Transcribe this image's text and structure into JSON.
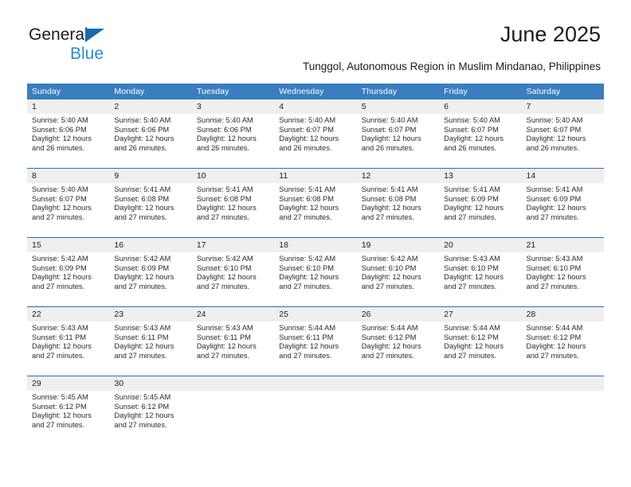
{
  "brand": {
    "line1": "General",
    "line2": "Blue",
    "triangle_icon": "triangle-icon",
    "colors": {
      "triangle": "#1769b0",
      "blue_text": "#2e8bd4",
      "dark_text": "#1c1c1c"
    }
  },
  "header": {
    "title": "June 2025",
    "subtitle": "Tunggol, Autonomous Region in Muslim Mindanao, Philippines"
  },
  "calendar": {
    "header_bg": "#3a7dc0",
    "row_separator": "#2f6eb0",
    "daynum_bg": "#efefef",
    "weekday_headers": [
      "Sunday",
      "Monday",
      "Tuesday",
      "Wednesday",
      "Thursday",
      "Friday",
      "Saturday"
    ],
    "weeks": [
      [
        {
          "day": "1",
          "sunrise": "Sunrise: 5:40 AM",
          "sunset": "Sunset: 6:06 PM",
          "daylight": "Daylight: 12 hours and 26 minutes."
        },
        {
          "day": "2",
          "sunrise": "Sunrise: 5:40 AM",
          "sunset": "Sunset: 6:06 PM",
          "daylight": "Daylight: 12 hours and 26 minutes."
        },
        {
          "day": "3",
          "sunrise": "Sunrise: 5:40 AM",
          "sunset": "Sunset: 6:06 PM",
          "daylight": "Daylight: 12 hours and 26 minutes."
        },
        {
          "day": "4",
          "sunrise": "Sunrise: 5:40 AM",
          "sunset": "Sunset: 6:07 PM",
          "daylight": "Daylight: 12 hours and 26 minutes."
        },
        {
          "day": "5",
          "sunrise": "Sunrise: 5:40 AM",
          "sunset": "Sunset: 6:07 PM",
          "daylight": "Daylight: 12 hours and 26 minutes."
        },
        {
          "day": "6",
          "sunrise": "Sunrise: 5:40 AM",
          "sunset": "Sunset: 6:07 PM",
          "daylight": "Daylight: 12 hours and 26 minutes."
        },
        {
          "day": "7",
          "sunrise": "Sunrise: 5:40 AM",
          "sunset": "Sunset: 6:07 PM",
          "daylight": "Daylight: 12 hours and 26 minutes."
        }
      ],
      [
        {
          "day": "8",
          "sunrise": "Sunrise: 5:40 AM",
          "sunset": "Sunset: 6:07 PM",
          "daylight": "Daylight: 12 hours and 27 minutes."
        },
        {
          "day": "9",
          "sunrise": "Sunrise: 5:41 AM",
          "sunset": "Sunset: 6:08 PM",
          "daylight": "Daylight: 12 hours and 27 minutes."
        },
        {
          "day": "10",
          "sunrise": "Sunrise: 5:41 AM",
          "sunset": "Sunset: 6:08 PM",
          "daylight": "Daylight: 12 hours and 27 minutes."
        },
        {
          "day": "11",
          "sunrise": "Sunrise: 5:41 AM",
          "sunset": "Sunset: 6:08 PM",
          "daylight": "Daylight: 12 hours and 27 minutes."
        },
        {
          "day": "12",
          "sunrise": "Sunrise: 5:41 AM",
          "sunset": "Sunset: 6:08 PM",
          "daylight": "Daylight: 12 hours and 27 minutes."
        },
        {
          "day": "13",
          "sunrise": "Sunrise: 5:41 AM",
          "sunset": "Sunset: 6:09 PM",
          "daylight": "Daylight: 12 hours and 27 minutes."
        },
        {
          "day": "14",
          "sunrise": "Sunrise: 5:41 AM",
          "sunset": "Sunset: 6:09 PM",
          "daylight": "Daylight: 12 hours and 27 minutes."
        }
      ],
      [
        {
          "day": "15",
          "sunrise": "Sunrise: 5:42 AM",
          "sunset": "Sunset: 6:09 PM",
          "daylight": "Daylight: 12 hours and 27 minutes."
        },
        {
          "day": "16",
          "sunrise": "Sunrise: 5:42 AM",
          "sunset": "Sunset: 6:09 PM",
          "daylight": "Daylight: 12 hours and 27 minutes."
        },
        {
          "day": "17",
          "sunrise": "Sunrise: 5:42 AM",
          "sunset": "Sunset: 6:10 PM",
          "daylight": "Daylight: 12 hours and 27 minutes."
        },
        {
          "day": "18",
          "sunrise": "Sunrise: 5:42 AM",
          "sunset": "Sunset: 6:10 PM",
          "daylight": "Daylight: 12 hours and 27 minutes."
        },
        {
          "day": "19",
          "sunrise": "Sunrise: 5:42 AM",
          "sunset": "Sunset: 6:10 PM",
          "daylight": "Daylight: 12 hours and 27 minutes."
        },
        {
          "day": "20",
          "sunrise": "Sunrise: 5:43 AM",
          "sunset": "Sunset: 6:10 PM",
          "daylight": "Daylight: 12 hours and 27 minutes."
        },
        {
          "day": "21",
          "sunrise": "Sunrise: 5:43 AM",
          "sunset": "Sunset: 6:10 PM",
          "daylight": "Daylight: 12 hours and 27 minutes."
        }
      ],
      [
        {
          "day": "22",
          "sunrise": "Sunrise: 5:43 AM",
          "sunset": "Sunset: 6:11 PM",
          "daylight": "Daylight: 12 hours and 27 minutes."
        },
        {
          "day": "23",
          "sunrise": "Sunrise: 5:43 AM",
          "sunset": "Sunset: 6:11 PM",
          "daylight": "Daylight: 12 hours and 27 minutes."
        },
        {
          "day": "24",
          "sunrise": "Sunrise: 5:43 AM",
          "sunset": "Sunset: 6:11 PM",
          "daylight": "Daylight: 12 hours and 27 minutes."
        },
        {
          "day": "25",
          "sunrise": "Sunrise: 5:44 AM",
          "sunset": "Sunset: 6:11 PM",
          "daylight": "Daylight: 12 hours and 27 minutes."
        },
        {
          "day": "26",
          "sunrise": "Sunrise: 5:44 AM",
          "sunset": "Sunset: 6:12 PM",
          "daylight": "Daylight: 12 hours and 27 minutes."
        },
        {
          "day": "27",
          "sunrise": "Sunrise: 5:44 AM",
          "sunset": "Sunset: 6:12 PM",
          "daylight": "Daylight: 12 hours and 27 minutes."
        },
        {
          "day": "28",
          "sunrise": "Sunrise: 5:44 AM",
          "sunset": "Sunset: 6:12 PM",
          "daylight": "Daylight: 12 hours and 27 minutes."
        }
      ],
      [
        {
          "day": "29",
          "sunrise": "Sunrise: 5:45 AM",
          "sunset": "Sunset: 6:12 PM",
          "daylight": "Daylight: 12 hours and 27 minutes."
        },
        {
          "day": "30",
          "sunrise": "Sunrise: 5:45 AM",
          "sunset": "Sunset: 6:12 PM",
          "daylight": "Daylight: 12 hours and 27 minutes."
        },
        {
          "day": "",
          "sunrise": "",
          "sunset": "",
          "daylight": ""
        },
        {
          "day": "",
          "sunrise": "",
          "sunset": "",
          "daylight": ""
        },
        {
          "day": "",
          "sunrise": "",
          "sunset": "",
          "daylight": ""
        },
        {
          "day": "",
          "sunrise": "",
          "sunset": "",
          "daylight": ""
        },
        {
          "day": "",
          "sunrise": "",
          "sunset": "",
          "daylight": ""
        }
      ]
    ]
  }
}
